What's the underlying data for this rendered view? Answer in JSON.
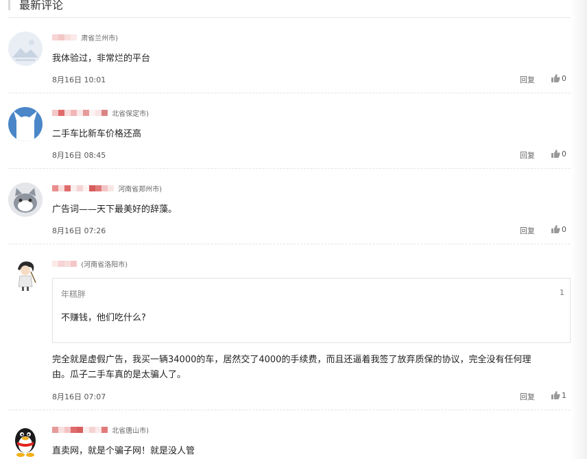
{
  "section_title": "最新评论",
  "comments": [
    {
      "location": "肃省兰州市)",
      "text": "我体验过，非常烂的平台",
      "date": "8月16日 10:01",
      "reply_label": "回复",
      "likes": "0",
      "avatar_icon": "landscape-placeholder-icon"
    },
    {
      "location": "北省保定市)",
      "text": "二手车比新车价格还高",
      "date": "8月16日 08:45",
      "reply_label": "回复",
      "likes": "0",
      "avatar_icon": "blue-cat-icon"
    },
    {
      "location": "河南省郑州市)",
      "text": "广告词——天下最美好的辞藻。",
      "date": "8月16日 07:26",
      "reply_label": "回复",
      "likes": "0",
      "avatar_icon": "gray-cat-icon"
    },
    {
      "location": "(河南省洛阳市)",
      "quote": {
        "name": "年糕胖",
        "number": "1",
        "text": "不赚钱，他们吃什么?"
      },
      "text_line1": "完全就是虚假广告，我买一辆34000的车，居然交了4000的手续费，而且还逼着我签了放弃质保的协议，完全没有任何理",
      "text_line2": "由。瓜子二手车真的是太骗人了。",
      "date": "8月16日 07:07",
      "reply_label": "回复",
      "likes": "1",
      "avatar_icon": "cartoon-character-icon"
    },
    {
      "location": "北省唐山市)",
      "text": "直卖网，就是个骗子网！就是没人管",
      "avatar_icon": "qq-penguin-icon"
    }
  ],
  "colors": {
    "blur_red": "#e06b6b",
    "blur_pink": "#f2b6b6",
    "separator": "#e3e3e3"
  }
}
